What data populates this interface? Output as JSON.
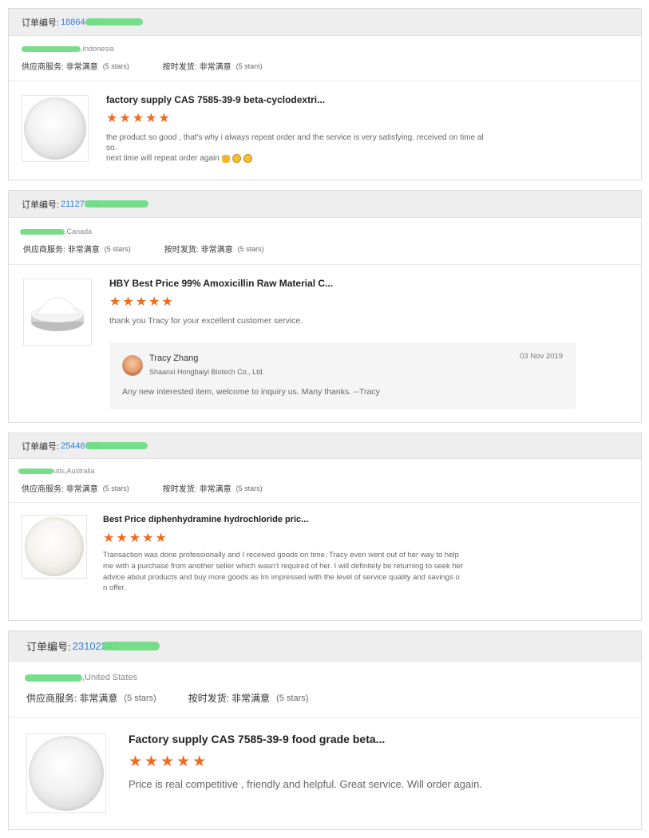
{
  "common": {
    "order_label": "订单编号:",
    "supplier_service_label": "供应商服务:",
    "on_time_delivery_label": "按时发货:",
    "very_satisfied": "非常满意",
    "five_stars": "(5 stars)",
    "star_glyph": "★",
    "accent_color": "#f26a1b",
    "link_color": "#2f7fd8"
  },
  "reviews": [
    {
      "order_no": "18864400",
      "buyer_location": ",Indonesia",
      "product_title": "factory supply CAS 7585-39-9 beta-cyclodextri...",
      "rating": 5,
      "review_text_1": "the product so good , that's why i always repeat order and the service is very satisfying. received on time al",
      "review_text_2": "so.",
      "review_text_3": "next time will repeat order again"
    },
    {
      "order_no": "21127835",
      "buyer_location": ",Canada",
      "product_title": "HBY Best Price 99% Amoxicillin Raw Material C...",
      "rating": 5,
      "review_text_1": "thank you Tracy for your excellent customer service.",
      "reply": {
        "name": "Tracy Zhang",
        "company": "Shaanxi Hongbaiyi Biotech Co., Ltd.",
        "date": "03 Nov 2019",
        "text": "Any new interested item, welcome to inquiry us.  Many thanks. --Tracy"
      }
    },
    {
      "order_no": "25446694",
      "buyer_location": "utis,Australia",
      "product_title": "Best Price diphenhydramine hydrochloride pric...",
      "rating": 5,
      "review_text_1": "Transaction was done professionally and I received goods on time. Tracy even went out of her way to help",
      "review_text_2": "me with a purchase from another seller which wasn't required of her. I will definitely be returning to seek her",
      "review_text_3": "advice about products and buy more goods as Im impressed with the level of service quality and savings o",
      "review_text_4": "n offer."
    },
    {
      "order_no": "23102347",
      "buyer_location": ",United States",
      "product_title": "Factory supply CAS 7585-39-9 food grade beta...",
      "rating": 5,
      "review_text_1": "Price is real competitive , friendly and helpful. Great service. Will order again."
    }
  ]
}
